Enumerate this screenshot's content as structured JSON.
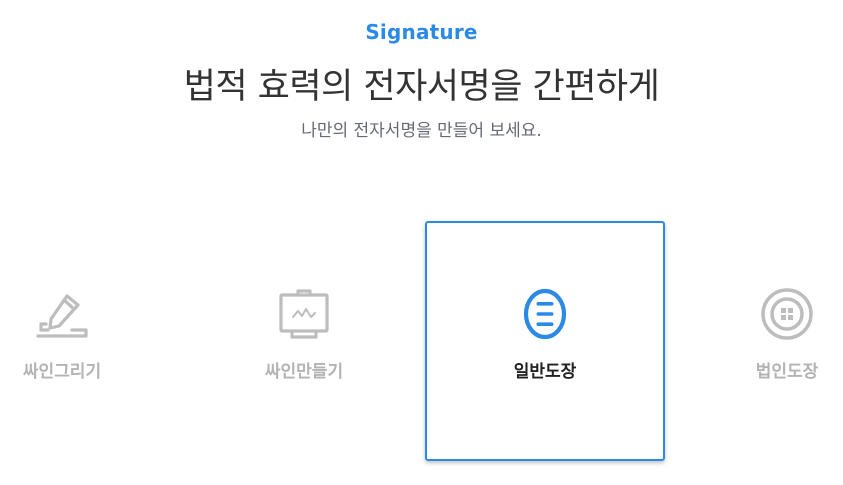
{
  "header": {
    "eyebrow": "Signature",
    "title": "법적 효력의 전자서명을 간편하게",
    "subtitle": "나만의 전자서명을 만들어 보세요."
  },
  "options": [
    {
      "label": "싸인그리기",
      "icon": "pen-draw-icon",
      "selected": false
    },
    {
      "label": "싸인만들기",
      "icon": "signature-monitor-icon",
      "selected": false
    },
    {
      "label": "일반도장",
      "icon": "seal-stamp-icon",
      "selected": true
    },
    {
      "label": "법인도장",
      "icon": "corporate-stamp-icon",
      "selected": false
    }
  ],
  "colors": {
    "accent": "#2b8ae6",
    "inactive": "#b3b3b3",
    "title": "#333333"
  }
}
